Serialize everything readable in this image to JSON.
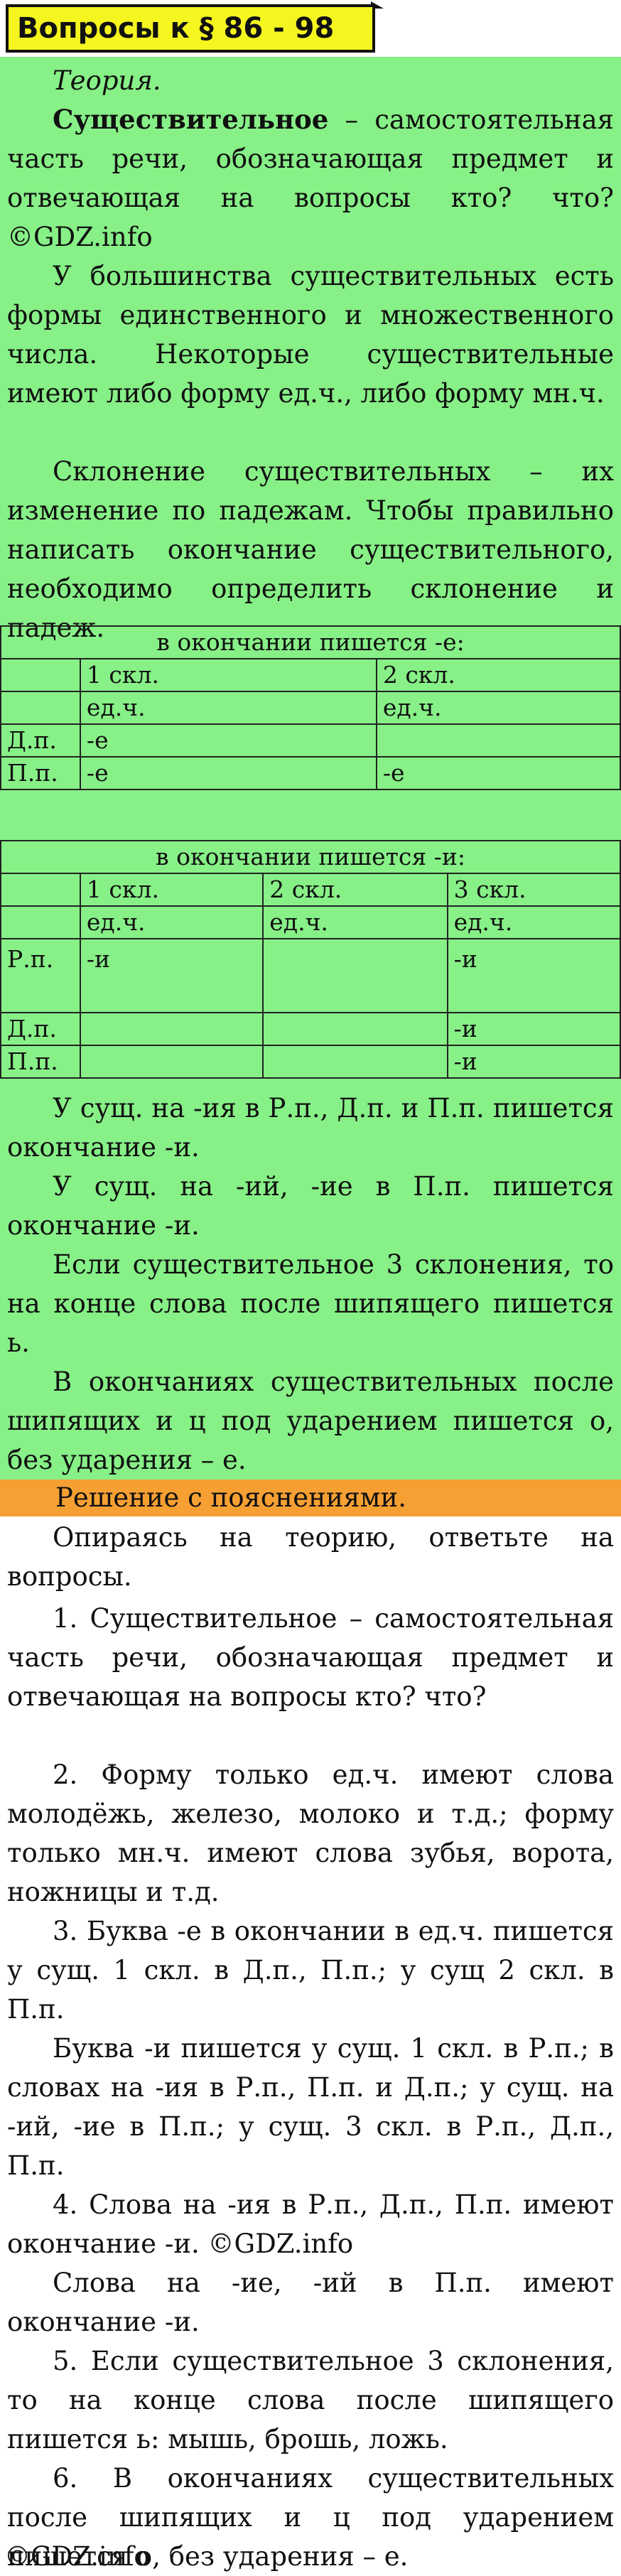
{
  "title": "Вопросы к § 86 - 98",
  "theory": {
    "heading": "Теория.",
    "p1_bold": "Существительное",
    "p1_rest": " – самостоятельная часть речи, обозначающая предмет и отвечающая на вопросы кто? что? ©GDZ.info",
    "p2": "У большинства существительных есть формы единственного и множественного числа. Некоторые существительные имеют либо форму ед.ч., либо форму мн.ч.",
    "p3": "Склонение существительных – их изменение по падежам. Чтобы правильно написать окончание существительного, необходимо определить склонение и падеж."
  },
  "table_e": {
    "caption": "в окончании пишется -е:",
    "headers": [
      "1 скл.",
      "2 скл."
    ],
    "subheaders": [
      "ед.ч.",
      "ед.ч."
    ],
    "rows": [
      {
        "case": "Д.п.",
        "c1": "-е",
        "c2": ""
      },
      {
        "case": "П.п.",
        "c1": "-е",
        "c2": "-е"
      }
    ]
  },
  "table_i": {
    "caption": "в окончании пишется -и:",
    "headers": [
      "1 скл.",
      "2 скл.",
      "3 скл."
    ],
    "subheaders": [
      "ед.ч.",
      "ед.ч.",
      "ед.ч."
    ],
    "rows": [
      {
        "case": "Р.п.",
        "c1": "-и",
        "c2": "",
        "c3": "-и"
      },
      {
        "case": "Д.п.",
        "c1": "",
        "c2": "",
        "c3": "-и"
      },
      {
        "case": "П.п.",
        "c1": "",
        "c2": "",
        "c3": "-и"
      }
    ]
  },
  "rules": {
    "r1": "У сущ. на -ия в Р.п., Д.п. и П.п. пишется окончание -и.",
    "r2": "У сущ. на -ий, -ие в П.п. пишется окончание -и.",
    "r3": "Если существительное 3 склонения, то на конце слова после шипящего пишется ь.",
    "r4": "В окончаниях существительных после шипящих и ц под ударением пишется о, без ударения – е."
  },
  "solution": {
    "title": "Решение с пояснениями.",
    "intro": "Опираясь на теорию, ответьте на вопросы.",
    "a1": "1. Существительное – самостоятельная часть речи, обозначающая предмет и отвечающая на вопросы кто? что?",
    "a2": "2. Форму только ед.ч. имеют слова молодёжь, железо, молоко и т.д.; форму только мн.ч. имеют слова зубья, ворота, ножницы и т.д.",
    "a3": "3. Буква -е в окончании в ед.ч. пишется у сущ. 1 скл. в Д.п., П.п.; у сущ 2 скл. в П.п.",
    "a3b": "Буква -и пишется у сущ. 1 скл. в Р.п.; в словах на -ия в Р.п., П.п. и Д.п.; у сущ. на -ий, -ие в П.п.; у сущ. 3 скл. в Р.п., Д.п., П.п.",
    "a4": "4. Слова на -ия в Р.п., Д.п., П.п. имеют окончание -и. ©GDZ.info",
    "a4b": "Слова на -ие, -ий в П.п. имеют окончание -и.",
    "a5": "5. Если существительное 3 склонения, то на конце слова после шипящего пишется ь: мышь, брошь, ложь.",
    "a6": "6. В окончаниях существительных после шипящих и ц под ударением пишется о, без ударения – е.",
    "footer": "©GDZ.info"
  },
  "colors": {
    "theory_bg": "#87f087",
    "title_bg": "#f5f520",
    "solution_bar": "#f6a033"
  }
}
